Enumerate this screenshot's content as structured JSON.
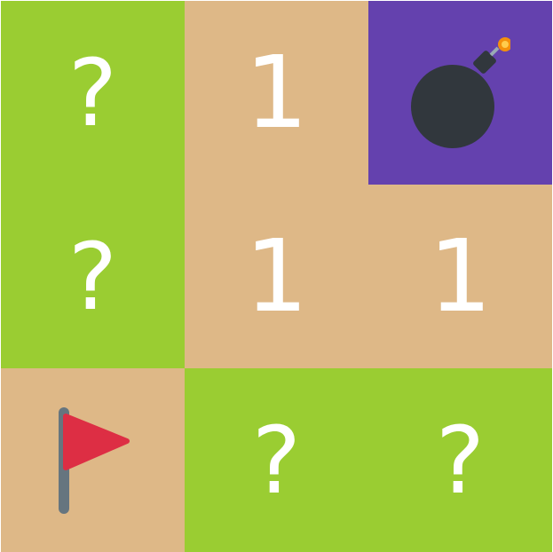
{
  "colors": {
    "unrevealed": "#9acd32",
    "revealed": "#deb887",
    "mine_background": "#6441ae",
    "number_text": "#ffffff",
    "bomb_body": "#31373d",
    "bomb_fuse_spark": "#f4900c",
    "flag_red": "#dd2e44",
    "flag_pole": "#66757f"
  },
  "board": {
    "rows": 3,
    "cols": 3,
    "cells": [
      {
        "state": "unrevealed",
        "text": "?"
      },
      {
        "state": "revealed",
        "text": "1"
      },
      {
        "state": "mine",
        "text": "",
        "icon": "bomb-icon"
      },
      {
        "state": "unrevealed",
        "text": "?"
      },
      {
        "state": "revealed",
        "text": "1"
      },
      {
        "state": "revealed",
        "text": "1"
      },
      {
        "state": "flagged",
        "text": "",
        "icon": "flag-icon"
      },
      {
        "state": "unrevealed",
        "text": "?"
      },
      {
        "state": "unrevealed",
        "text": "?"
      }
    ]
  }
}
